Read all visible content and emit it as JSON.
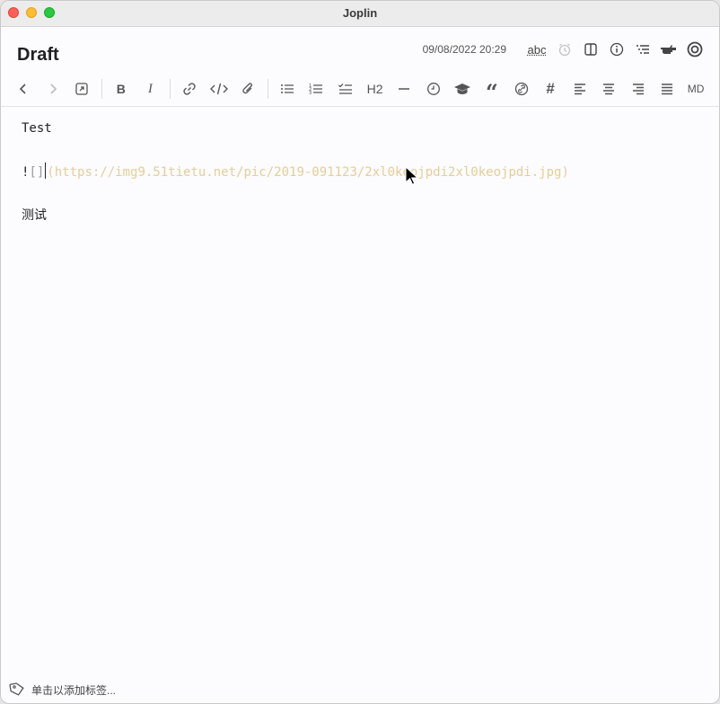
{
  "window": {
    "title": "Joplin"
  },
  "note": {
    "title": "Draft",
    "date": "09/08/2022 20:29",
    "spellcheck_label": "abc"
  },
  "toolbar": {
    "heading_label": "H2",
    "md_label": "MD"
  },
  "editor": {
    "line1": "Test",
    "line2_prefix": "!",
    "line2_brackets": "[]",
    "line2_url": "(https://img9.51tietu.net/pic/2019-091123/2xl0keojpdi2xl0keojpdi.jpg)",
    "line3": "测试"
  },
  "footer": {
    "tag_placeholder": "单击以添加标签..."
  },
  "colors": {
    "url": "#e3cf96",
    "accent": "#3b3b3b"
  }
}
